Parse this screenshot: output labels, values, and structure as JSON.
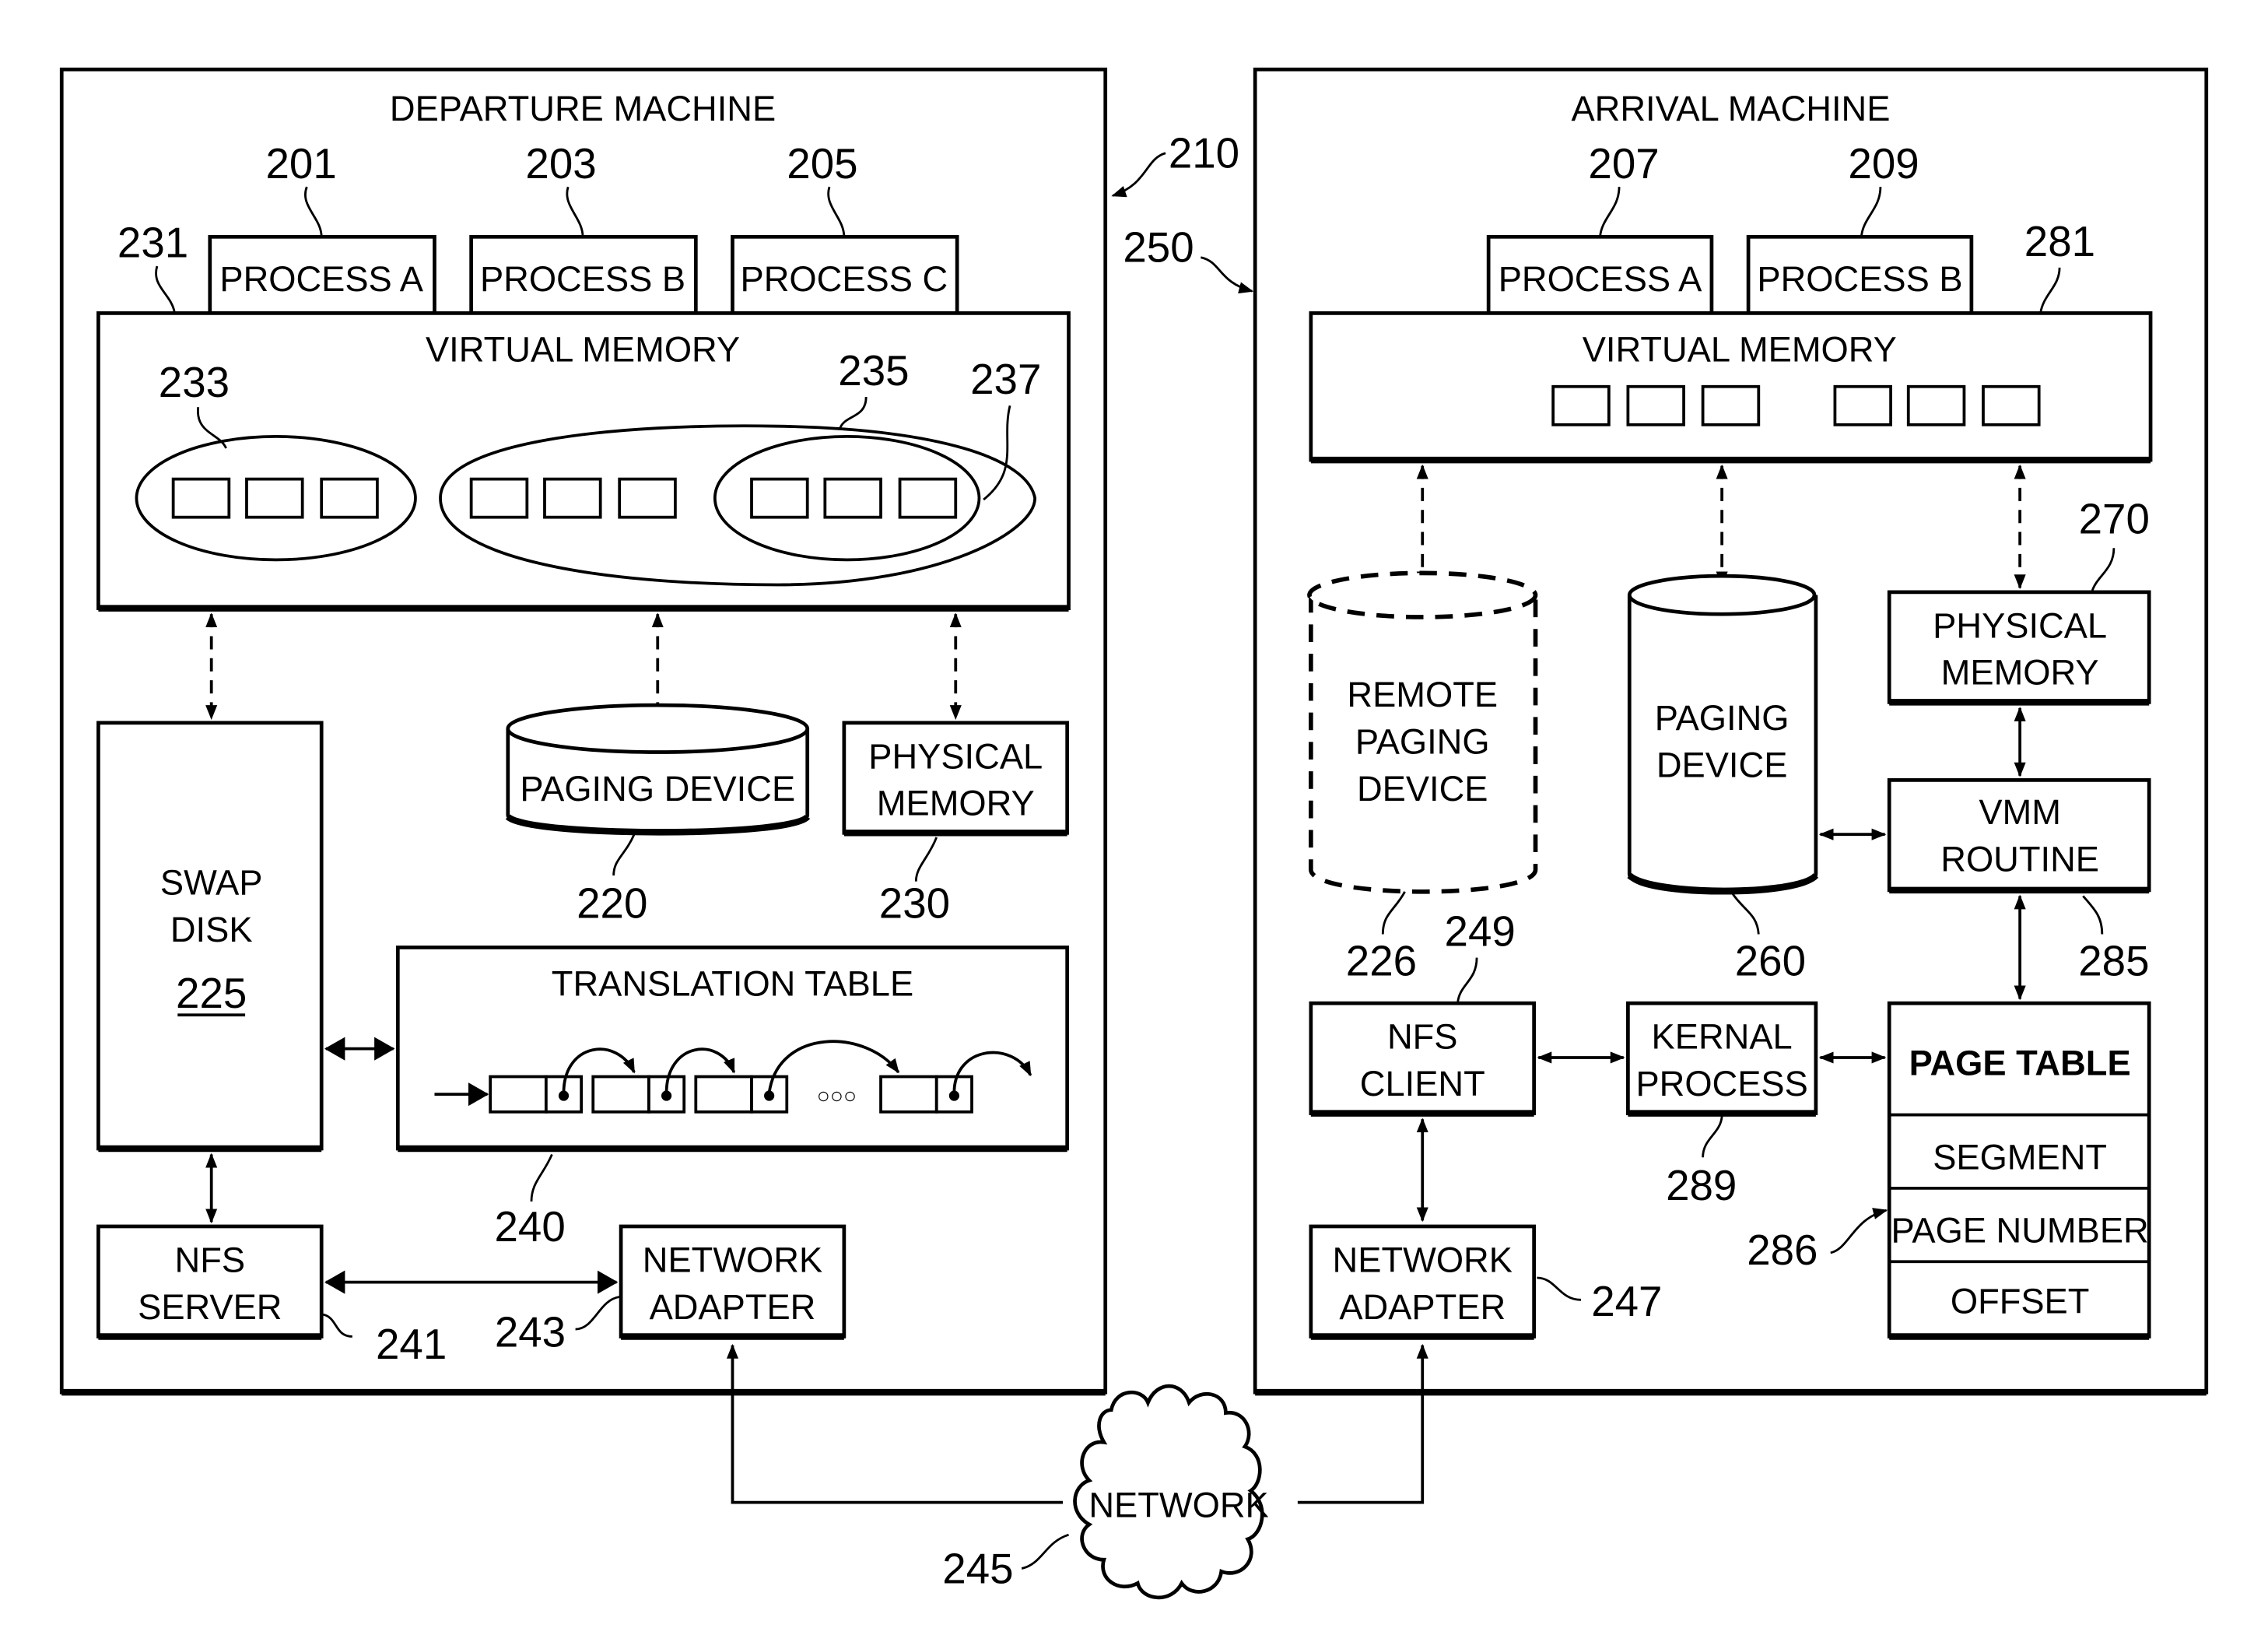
{
  "figure_ref": "210",
  "departure": {
    "title": "DEPARTURE MACHINE",
    "ref": "210",
    "processes": [
      {
        "label": "PROCESS A",
        "ref": "201"
      },
      {
        "label": "PROCESS B",
        "ref": "203"
      },
      {
        "label": "PROCESS C",
        "ref": "205"
      }
    ],
    "virtual_memory": {
      "label": "VIRTUAL MEMORY",
      "ref": "231",
      "groups": [
        "233",
        "235",
        "237"
      ]
    },
    "swap_disk": {
      "line1": "SWAP",
      "line2": "DISK",
      "ref": "225"
    },
    "paging_device": {
      "label": "PAGING DEVICE",
      "ref": "220"
    },
    "physical_memory": {
      "line1": "PHYSICAL",
      "line2": "MEMORY",
      "ref": "230"
    },
    "translation_table": {
      "label": "TRANSLATION TABLE",
      "ref": "240",
      "ellipsis": "○○○"
    },
    "nfs_server": {
      "line1": "NFS",
      "line2": "SERVER",
      "ref": "241"
    },
    "network_adapter": {
      "line1": "NETWORK",
      "line2": "ADAPTER",
      "ref": "243"
    }
  },
  "arrival": {
    "title": "ARRIVAL MACHINE",
    "ref": "250",
    "processes": [
      {
        "label": "PROCESS A",
        "ref": "207"
      },
      {
        "label": "PROCESS B",
        "ref": "209"
      }
    ],
    "virtual_memory": {
      "label": "VIRTUAL MEMORY",
      "ref": "281"
    },
    "remote_paging_device": {
      "line1": "REMOTE",
      "line2": "PAGING",
      "line3": "DEVICE",
      "ref": "226"
    },
    "paging_device": {
      "line1": "PAGING",
      "line2": "DEVICE",
      "ref": "260"
    },
    "physical_memory": {
      "line1": "PHYSICAL",
      "line2": "MEMORY",
      "ref": "270"
    },
    "vmm_routine": {
      "line1": "VMM",
      "line2": "ROUTINE",
      "ref": "285"
    },
    "nfs_client": {
      "line1": "NFS",
      "line2": "CLIENT",
      "ref": "249"
    },
    "kernal_process": {
      "line1": "KERNAL",
      "line2": "PROCESS",
      "ref": "289"
    },
    "page_table": {
      "title": "PAGE TABLE",
      "rows": [
        "SEGMENT",
        "PAGE NUMBER",
        "OFFSET"
      ],
      "ref": "286"
    },
    "network_adapter": {
      "line1": "NETWORK",
      "line2": "ADAPTER",
      "ref": "247"
    }
  },
  "network": {
    "label": "NETWORK",
    "ref": "245"
  }
}
